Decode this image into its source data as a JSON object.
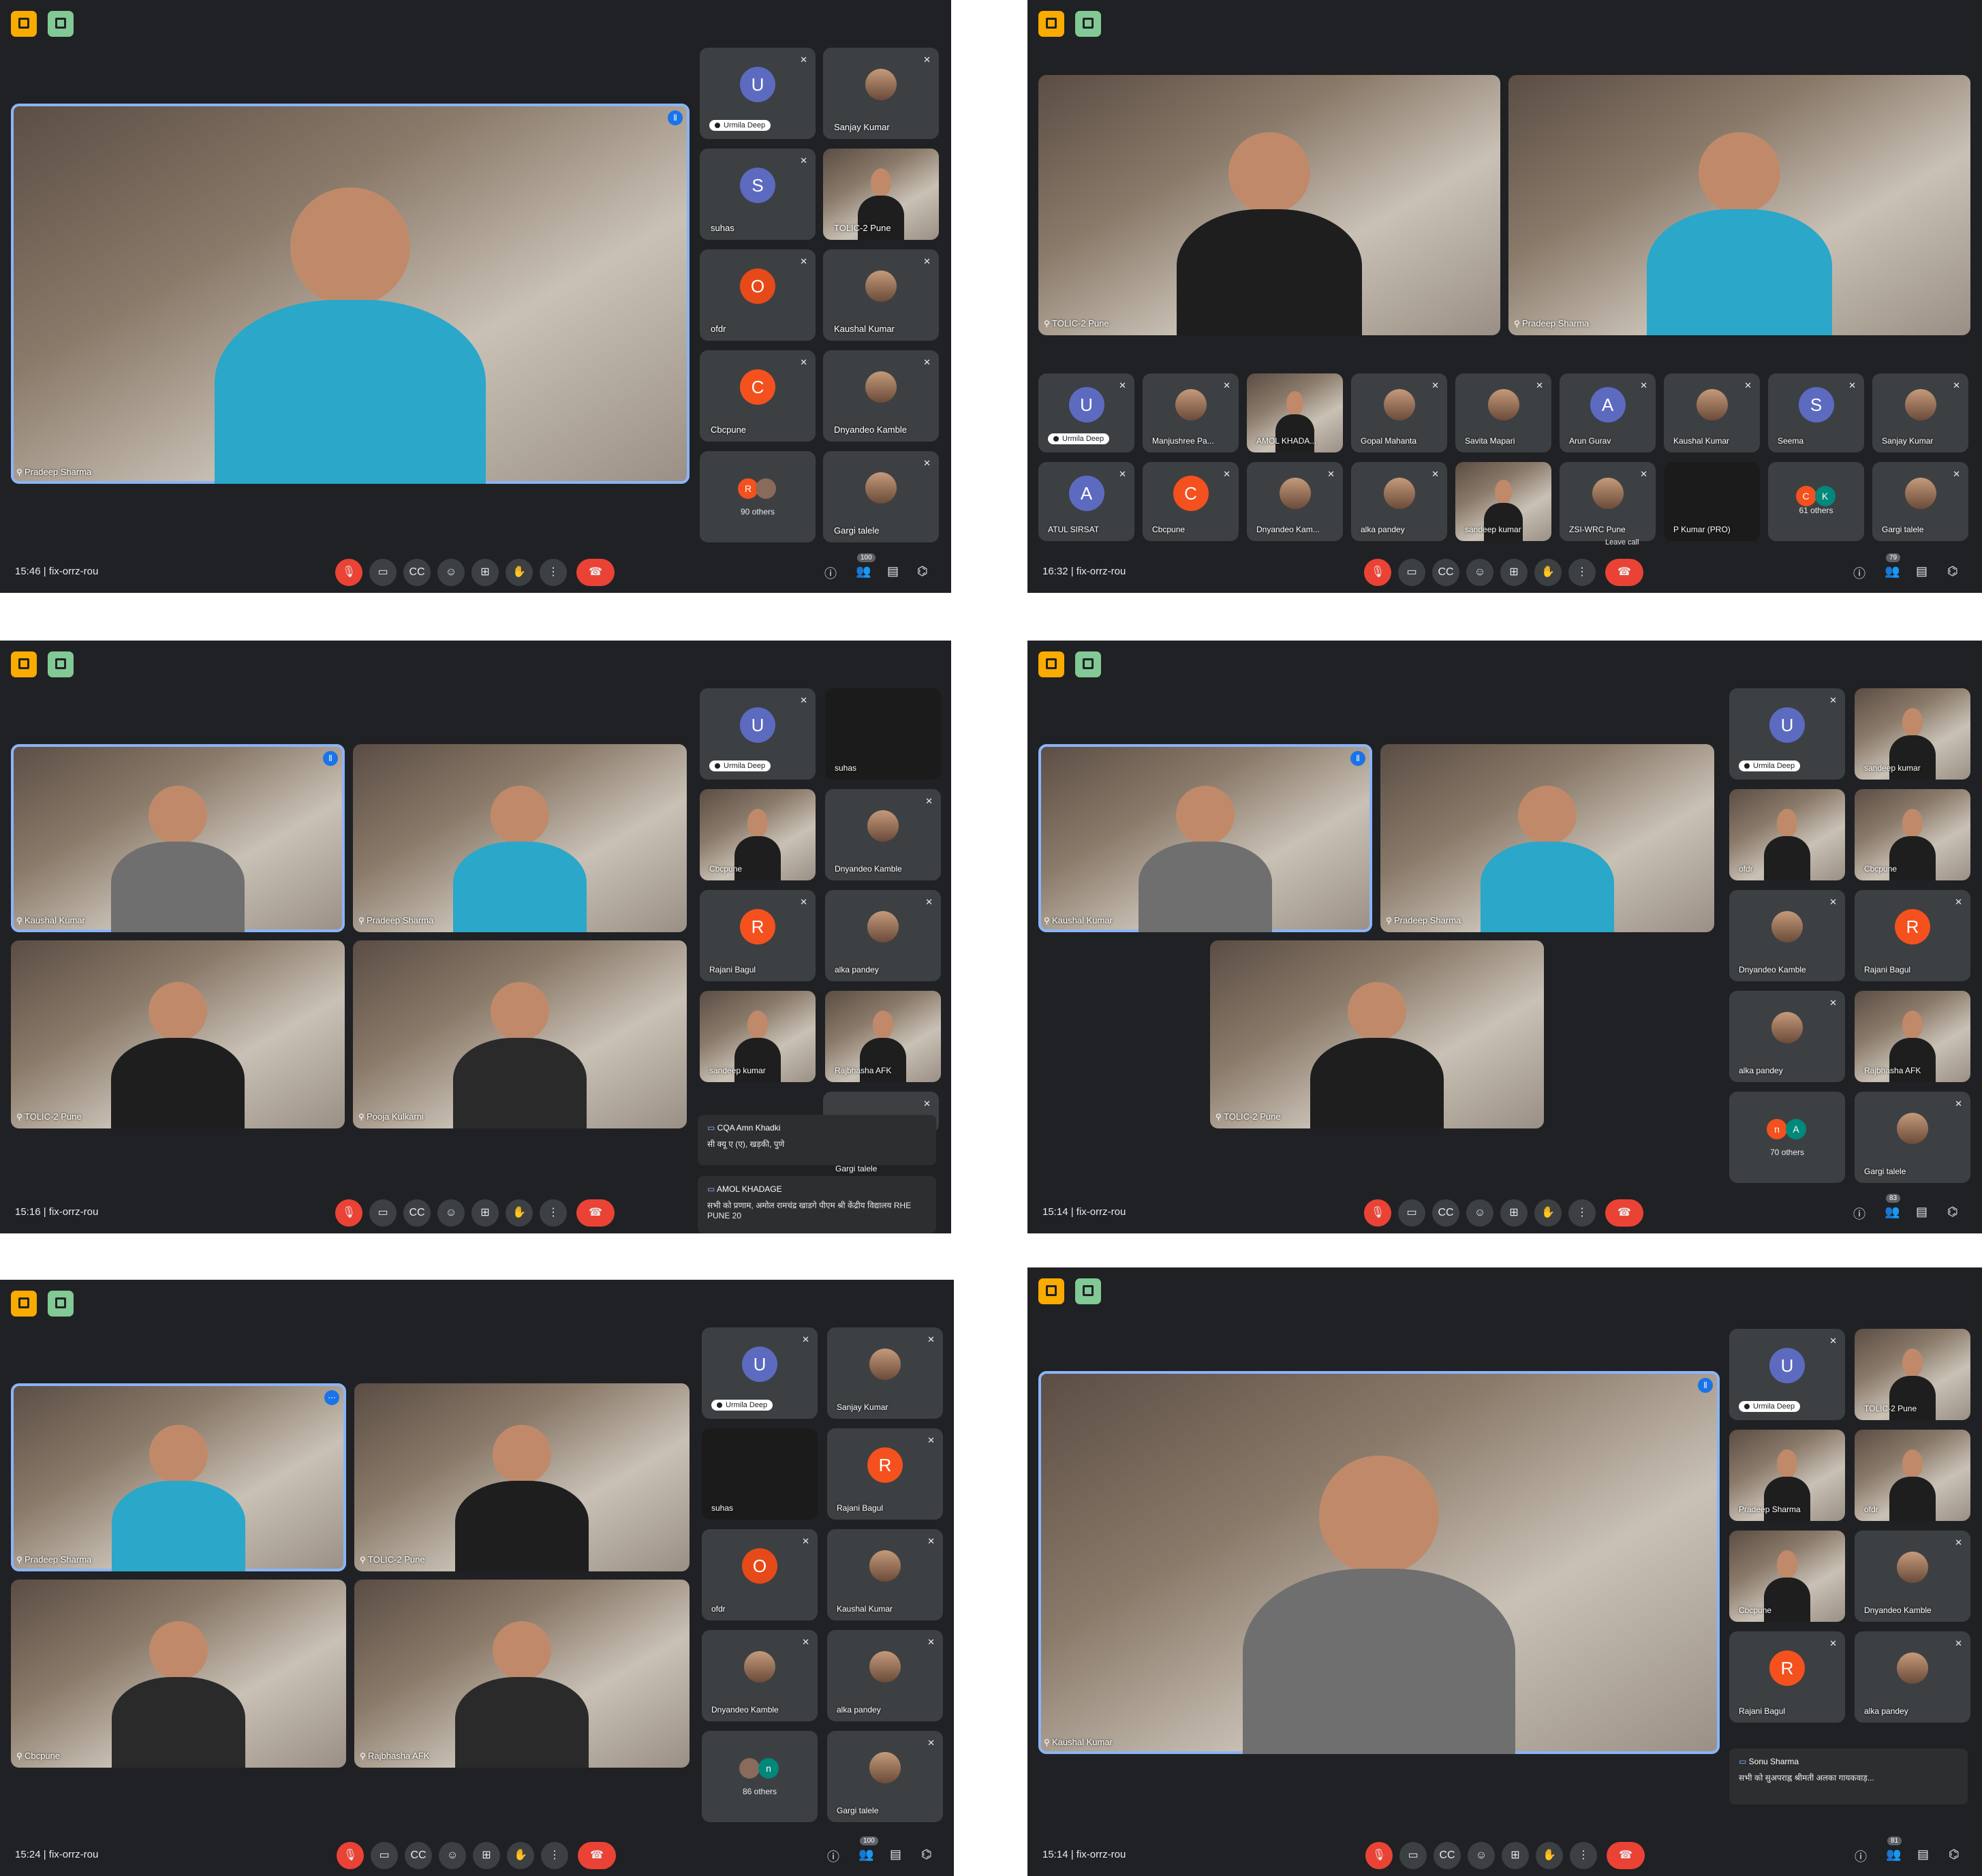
{
  "meeting_code": "fix-orrz-rou",
  "panels": [
    {
      "time": "15:46",
      "main": {
        "name": "Pradeep Sharma"
      },
      "side": [
        {
          "name": "Urmila Deep",
          "initial": "U",
          "pill": true
        },
        {
          "name": "Sanjay Kumar",
          "photo": true
        },
        {
          "name": "suhas",
          "initial": "S"
        },
        {
          "name": "TOLIC-2 Pune",
          "video": true
        },
        {
          "name": "ofdr",
          "initial": "O"
        },
        {
          "name": "Kaushal Kumar",
          "photo": true
        },
        {
          "name": "Cbcpune",
          "initial": "C"
        },
        {
          "name": "Dnyandeo Kamble",
          "photo": true
        },
        {
          "name": "90 others",
          "initial": "R"
        },
        {
          "name": "Gargi talele",
          "photo": true
        }
      ],
      "participants_count": "100"
    },
    {
      "time": "16:32",
      "main": [
        {
          "name": "TOLIC-2 Pune"
        },
        {
          "name": "Pradeep Sharma"
        }
      ],
      "row1": [
        {
          "name": "Urmila Deep",
          "initial": "U",
          "pill": true
        },
        {
          "name": "Manjushree Pa...",
          "photo": true
        },
        {
          "name": "AMOL KHADA...",
          "video": true
        },
        {
          "name": "Gopal Mahanta",
          "photo": true
        },
        {
          "name": "Savita Mapari",
          "photo": true
        },
        {
          "name": "Arun Gurav",
          "initial": "A"
        },
        {
          "name": "Kaushal Kumar",
          "photo": true
        },
        {
          "name": "Seema",
          "initial": "S"
        },
        {
          "name": "Sanjay Kumar",
          "photo": true
        }
      ],
      "row2": [
        {
          "name": "ATUL SIRSAT",
          "initial": "A"
        },
        {
          "name": "Cbcpune",
          "initial": "C"
        },
        {
          "name": "Dnyandeo Kam...",
          "photo": true
        },
        {
          "name": "alka pandey",
          "photo": true
        },
        {
          "name": "sandeep kumar",
          "video": true
        },
        {
          "name": "ZSI-WRC Pune",
          "photo": true
        },
        {
          "name": "P Kumar (PRO)",
          "dark": true
        },
        {
          "name": "61 others",
          "initials": [
            "C",
            "K"
          ]
        },
        {
          "name": "Gargi talele",
          "photo": true
        }
      ],
      "leave_tooltip": "Leave call",
      "participants_count": "79"
    },
    {
      "time": "15:16",
      "grid": [
        {
          "name": "Kaushal Kumar"
        },
        {
          "name": "Pradeep Sharma"
        },
        {
          "name": "TOLIC-2 Pune"
        },
        {
          "name": "Pooja Kulkarni"
        }
      ],
      "side": [
        {
          "name": "Urmila Deep",
          "initial": "U",
          "pill": true
        },
        {
          "name": "suhas",
          "dark": true
        },
        {
          "name": "Cbcpune",
          "video": true
        },
        {
          "name": "Dnyandeo Kamble",
          "photo": true
        },
        {
          "name": "Rajani Bagul",
          "initial": "R"
        },
        {
          "name": "alka pandey",
          "photo": true
        },
        {
          "name": "sandeep kumar",
          "video": true
        },
        {
          "name": "Rajbhasha AFK",
          "video": true
        }
      ],
      "chats": [
        {
          "who": "CQA Amn Khadki",
          "text": "सी क्यू ए (ए), खड़की, पुणे"
        },
        {
          "who": "AMOL KHADAGE",
          "text": "सभी को प्रणाम, अमोल रामचंद्र खाडगे पीएम श्री केंद्रीय विद्यालय RHE PUNE 20"
        }
      ],
      "under_chat": "Gargi talele"
    },
    {
      "time": "15:14",
      "grid": [
        {
          "name": "Kaushal Kumar"
        },
        {
          "name": "Pradeep Sharma"
        },
        {
          "name": "TOLIC-2 Pune"
        }
      ],
      "side": [
        {
          "name": "Urmila Deep",
          "initial": "U",
          "pill": true
        },
        {
          "name": "sandeep kumar",
          "video": true
        },
        {
          "name": "ofdr",
          "video": true
        },
        {
          "name": "Cbcpune",
          "video": true
        },
        {
          "name": "Dnyandeo Kamble",
          "photo": true
        },
        {
          "name": "Rajani Bagul",
          "initial": "R"
        },
        {
          "name": "alka pandey",
          "photo": true
        },
        {
          "name": "Rajbhasha AFK",
          "video": true
        },
        {
          "name": "70 others",
          "initials": [
            "n",
            "A"
          ]
        },
        {
          "name": "Gargi talele",
          "photo": true
        }
      ],
      "participants_count": "83"
    },
    {
      "time": "15:24",
      "grid": [
        {
          "name": "Pradeep Sharma"
        },
        {
          "name": "TOLIC-2 Pune"
        },
        {
          "name": "Cbcpune"
        },
        {
          "name": "Rajbhasha AFK"
        }
      ],
      "side": [
        {
          "name": "Urmila Deep",
          "initial": "U",
          "pill": true
        },
        {
          "name": "Sanjay Kumar",
          "photo": true
        },
        {
          "name": "suhas",
          "dark": true
        },
        {
          "name": "Rajani Bagul",
          "initial": "R"
        },
        {
          "name": "ofdr",
          "initial": "O"
        },
        {
          "name": "Kaushal Kumar",
          "photo": true
        },
        {
          "name": "Dnyandeo Kamble",
          "photo": true
        },
        {
          "name": "alka pandey",
          "photo": true
        },
        {
          "name": "86 others",
          "initials": [
            "",
            "n"
          ]
        },
        {
          "name": "Gargi talele",
          "photo": true
        }
      ],
      "participants_count": "100"
    },
    {
      "time": "15:14",
      "main": {
        "name": "Kaushal Kumar"
      },
      "side": [
        {
          "name": "Urmila Deep",
          "initial": "U",
          "pill": true
        },
        {
          "name": "TOLIC-2 Pune",
          "video": true
        },
        {
          "name": "Pradeep Sharma",
          "video": true
        },
        {
          "name": "ofdr",
          "video": true
        },
        {
          "name": "Cbcpune",
          "video": true
        },
        {
          "name": "Dnyandeo Kamble",
          "photo": true
        },
        {
          "name": "Rajani Bagul",
          "initial": "R"
        },
        {
          "name": "alka pandey",
          "photo": true
        }
      ],
      "chat": {
        "who": "Sonu Sharma",
        "text": "सभी को सुअपराह्न श्रीमती अलका गायकवाड़..."
      },
      "participants_count": "81"
    }
  ],
  "icons": [
    "mic-off-icon",
    "camera-off-icon",
    "captions-icon",
    "emoji-icon",
    "present-icon",
    "raise-hand-icon",
    "more-icon",
    "end-call-icon",
    "info-icon",
    "people-icon",
    "chat-icon",
    "activities-icon",
    "pin-icon"
  ]
}
